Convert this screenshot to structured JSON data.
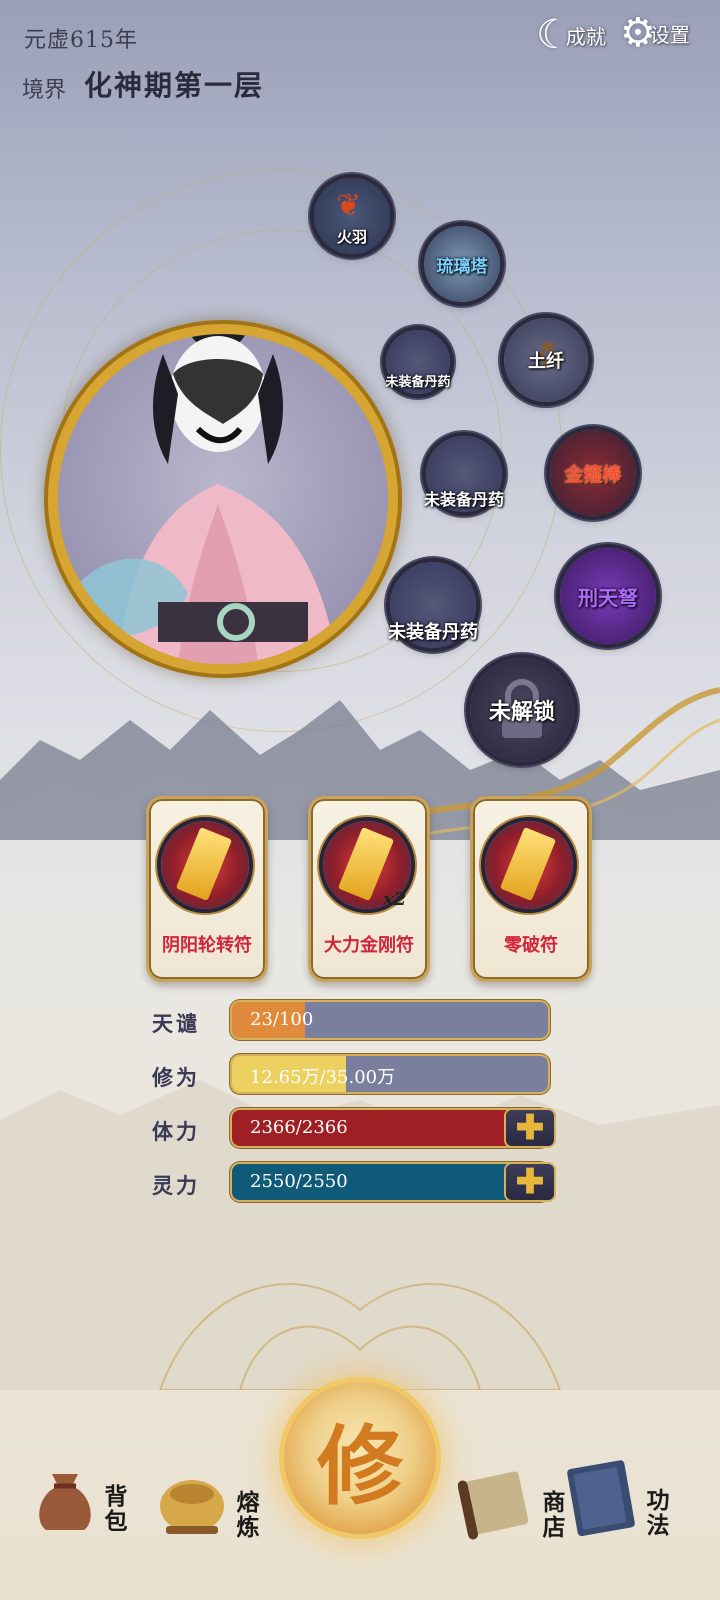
{
  "header": {
    "era": "元虚615年",
    "realm_label": "境界",
    "realm_value": "化神期第一层",
    "achievements_label": "成就",
    "settings_label": "设置"
  },
  "equipment": {
    "fire_feather": "火羽",
    "glazed_tower": "琉璃塔",
    "pill_1": "未装备丹药",
    "earth_fiber": "土纤",
    "pill_2": "未装备丹药",
    "golden_staff": "金箍棒",
    "pill_3": "未装备丹药",
    "punishment_bow": "刑天弩",
    "locked": "未解锁"
  },
  "talismans": [
    {
      "name": "阴阳轮转符",
      "count": ""
    },
    {
      "name": "大力金刚符",
      "count": "x2"
    },
    {
      "name": "零破符",
      "count": ""
    }
  ],
  "stats": {
    "heaven_label": "天谴",
    "heaven_value": "23/100",
    "heaven_fill": 0.23,
    "cultivation_label": "修为",
    "cultivation_value": "12.65万/35.00万",
    "cultivation_fill": 0.36,
    "stamina_label": "体力",
    "stamina_value": "2366/2366",
    "stamina_fill": 1.0,
    "spirit_label": "灵力",
    "spirit_value": "2550/2550",
    "spirit_fill": 1.0
  },
  "nav": {
    "bag": "背包",
    "refine": "熔炼",
    "cultivate": "修",
    "shop": "商店",
    "skills": "功法"
  },
  "colors": {
    "heaven_bar": "#e08a3c",
    "cultivation_bar": "#ecd060",
    "stamina_bar": "#9f2024",
    "spirit_bar": "#0f5a78",
    "gold": "#d6b05a"
  }
}
